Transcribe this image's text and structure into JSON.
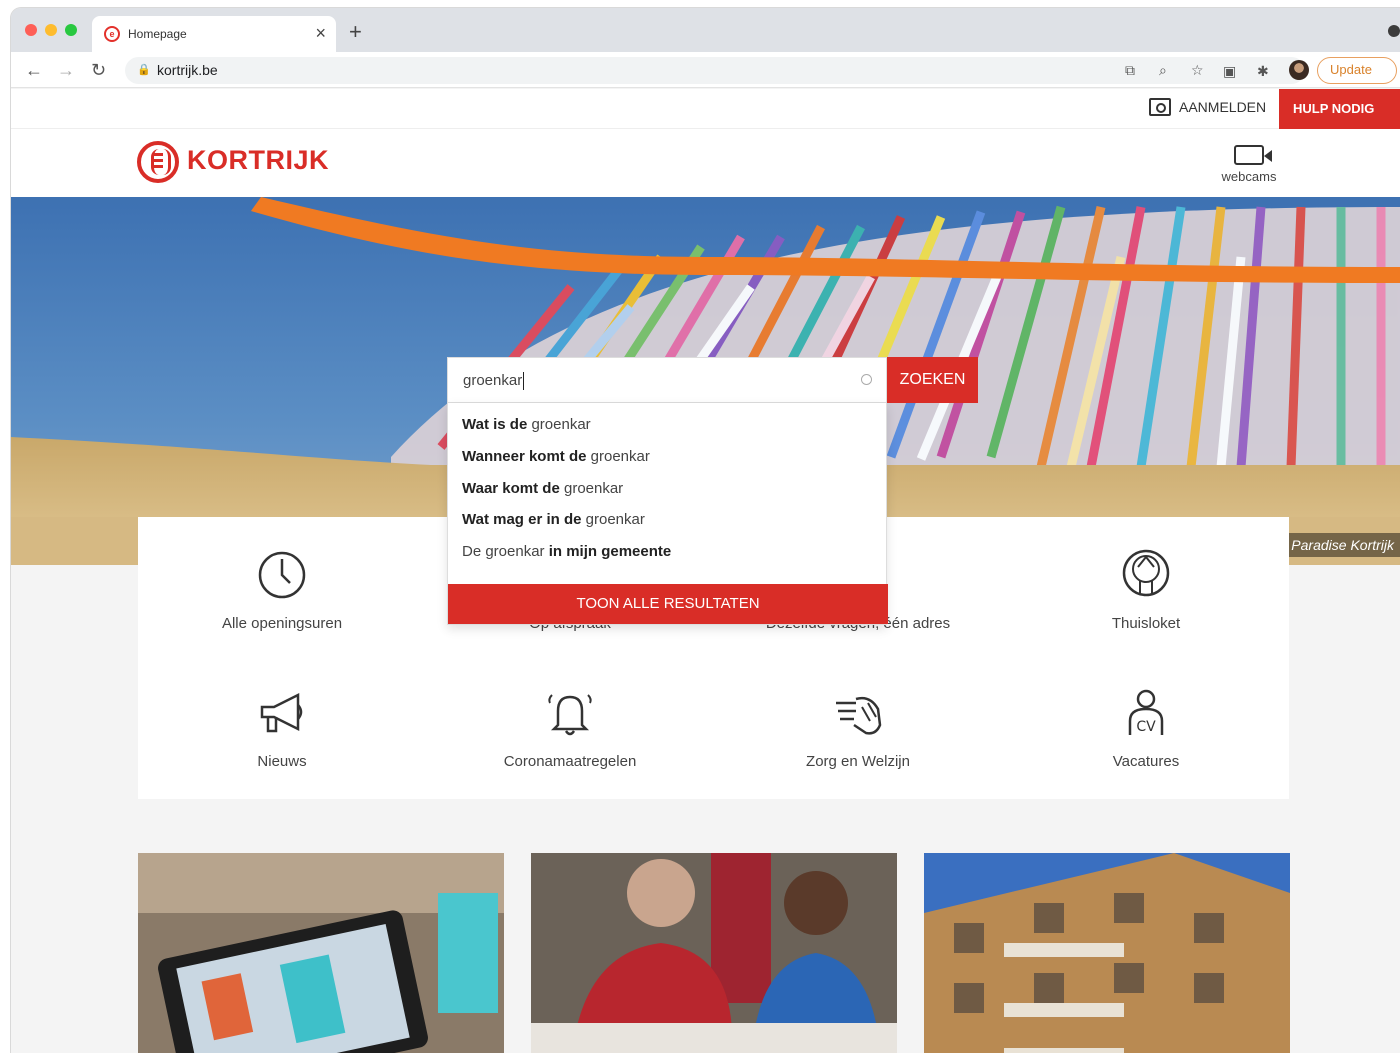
{
  "browser": {
    "tab_title": "Homepage",
    "url": "kortrijk.be",
    "update_label": "Update"
  },
  "topbar": {
    "login_label": "AANMELDEN",
    "help_label": "HULP NODIG"
  },
  "header": {
    "logo_text": "KORTRIJK",
    "webcams_label": "webcams"
  },
  "hero": {
    "credit": "Paradise Kortrijk"
  },
  "search": {
    "value": "groenkar",
    "button_label": "ZOEKEN",
    "suggestions": [
      {
        "bold": "Wat is de",
        "normal": " groenkar"
      },
      {
        "bold": "Wanneer komt de",
        "normal": " groenkar"
      },
      {
        "bold": "Waar komt de",
        "normal": " groenkar"
      },
      {
        "bold": "Wat mag er in de",
        "normal": " groenkar"
      },
      {
        "normal": "De groenkar ",
        "bold": "in mijn gemeente"
      }
    ],
    "show_all_label": "TOON ALLE RESULTATEN"
  },
  "services": [
    {
      "label": "Alle openingsuren",
      "icon": "clock-icon"
    },
    {
      "label": "Op afspraak",
      "icon": "calendar-icon"
    },
    {
      "label": "Dezelfde vragen, één adres",
      "icon": "number-icon"
    },
    {
      "label": "Thuisloket",
      "icon": "thuisloket-icon"
    },
    {
      "label": "Nieuws",
      "icon": "megaphone-icon"
    },
    {
      "label": "Coronamaatregelen",
      "icon": "bell-icon"
    },
    {
      "label": "Zorg en Welzijn",
      "icon": "hands-icon"
    },
    {
      "label": "Vacatures",
      "icon": "cv-icon"
    }
  ],
  "colors": {
    "brand_red": "#d92d27"
  }
}
